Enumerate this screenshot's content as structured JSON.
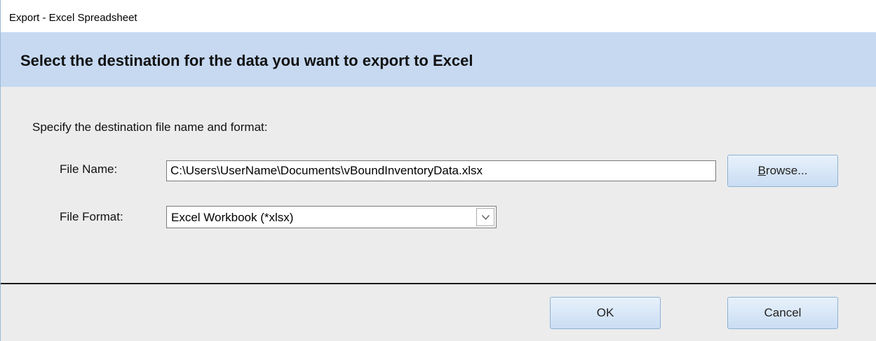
{
  "window": {
    "title": "Export - Excel Spreadsheet"
  },
  "banner": {
    "heading": "Select the destination for the data you want to export to Excel"
  },
  "form": {
    "instruction": "Specify the destination file name and format:",
    "file_name_label": "File Name:",
    "file_name_value": "C:\\Users\\UserName\\Documents\\vBoundInventoryData.xlsx",
    "file_format_label": "File Format:",
    "file_format_value": "Excel Workbook (*xlsx)",
    "browse_label_first": "B",
    "browse_label_rest": "rowse...",
    "dropdown_icon": "chevron-down-icon"
  },
  "footer": {
    "ok_label": "OK",
    "cancel_label": "Cancel"
  },
  "colors": {
    "banner_bg": "#c6d9f1",
    "content_bg": "#ececec",
    "button_border": "#8eb2d6",
    "window_border": "#9bb7d4"
  }
}
